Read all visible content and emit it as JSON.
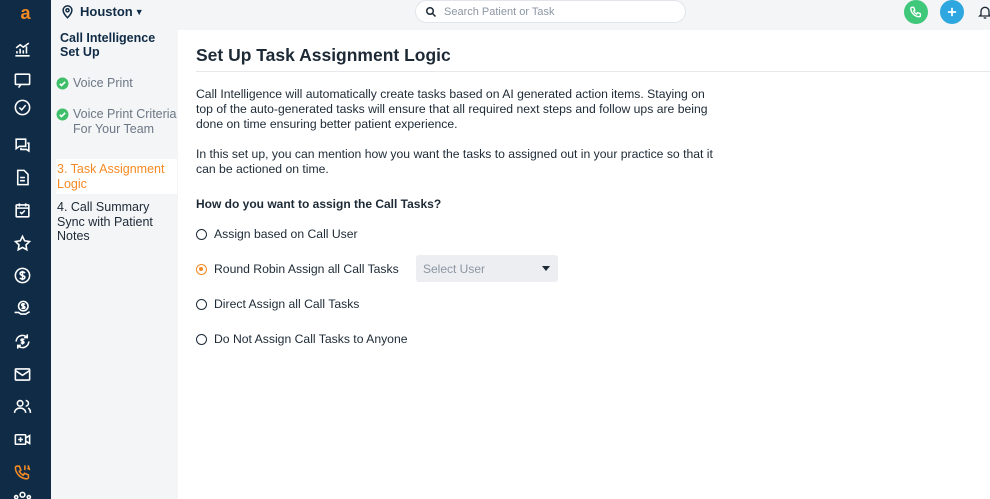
{
  "app": {
    "logo_letter": "a"
  },
  "nav_icons": [
    "analytics-icon",
    "chat-icon",
    "tasks-check-icon",
    "conversations-icon",
    "document-icon",
    "calendar-icon",
    "star-icon",
    "dollar-icon",
    "payments-icon",
    "recurring-payment-icon",
    "mail-icon",
    "patients-icon",
    "video-icon",
    "call-intelligence-icon",
    "team-icon"
  ],
  "topbar": {
    "location": "Houston",
    "search_placeholder": "Search Patient or Task"
  },
  "sidebar": {
    "heading": "Call Intelligence Set Up",
    "steps": [
      {
        "label": "Voice Print",
        "state": "done"
      },
      {
        "label": "Voice Print Criteria For Your Team",
        "state": "done"
      },
      {
        "label": "3. Task Assignment Logic",
        "state": "current"
      },
      {
        "label": "4. Call Summary Sync with Patient Notes",
        "state": "todo"
      }
    ]
  },
  "main": {
    "title": "Set Up Task Assignment Logic",
    "paragraph1": "Call Intelligence will automatically create tasks based on AI generated action items. Staying on top of the auto-generated tasks will ensure that all required next steps and follow ups are being done on time ensuring better patient experience.",
    "paragraph2": "In this set up, you can mention how you want the tasks to assigned out in your practice so that it can be actioned on time.",
    "question": "How do you want to assign the Call Tasks?",
    "options": [
      {
        "label": "Assign based on Call User",
        "selected": false
      },
      {
        "label": "Round Robin Assign all Call Tasks",
        "selected": true
      },
      {
        "label": "Direct Assign all Call Tasks",
        "selected": false
      },
      {
        "label": "Do Not Assign Call Tasks to Anyone",
        "selected": false
      }
    ],
    "select_user_placeholder": "Select User"
  },
  "colors": {
    "accent": "#f58a24",
    "rail": "#0f2b45",
    "success": "#3fbf6a",
    "call_button": "#3fc77a",
    "add_button": "#2ea6e0"
  }
}
